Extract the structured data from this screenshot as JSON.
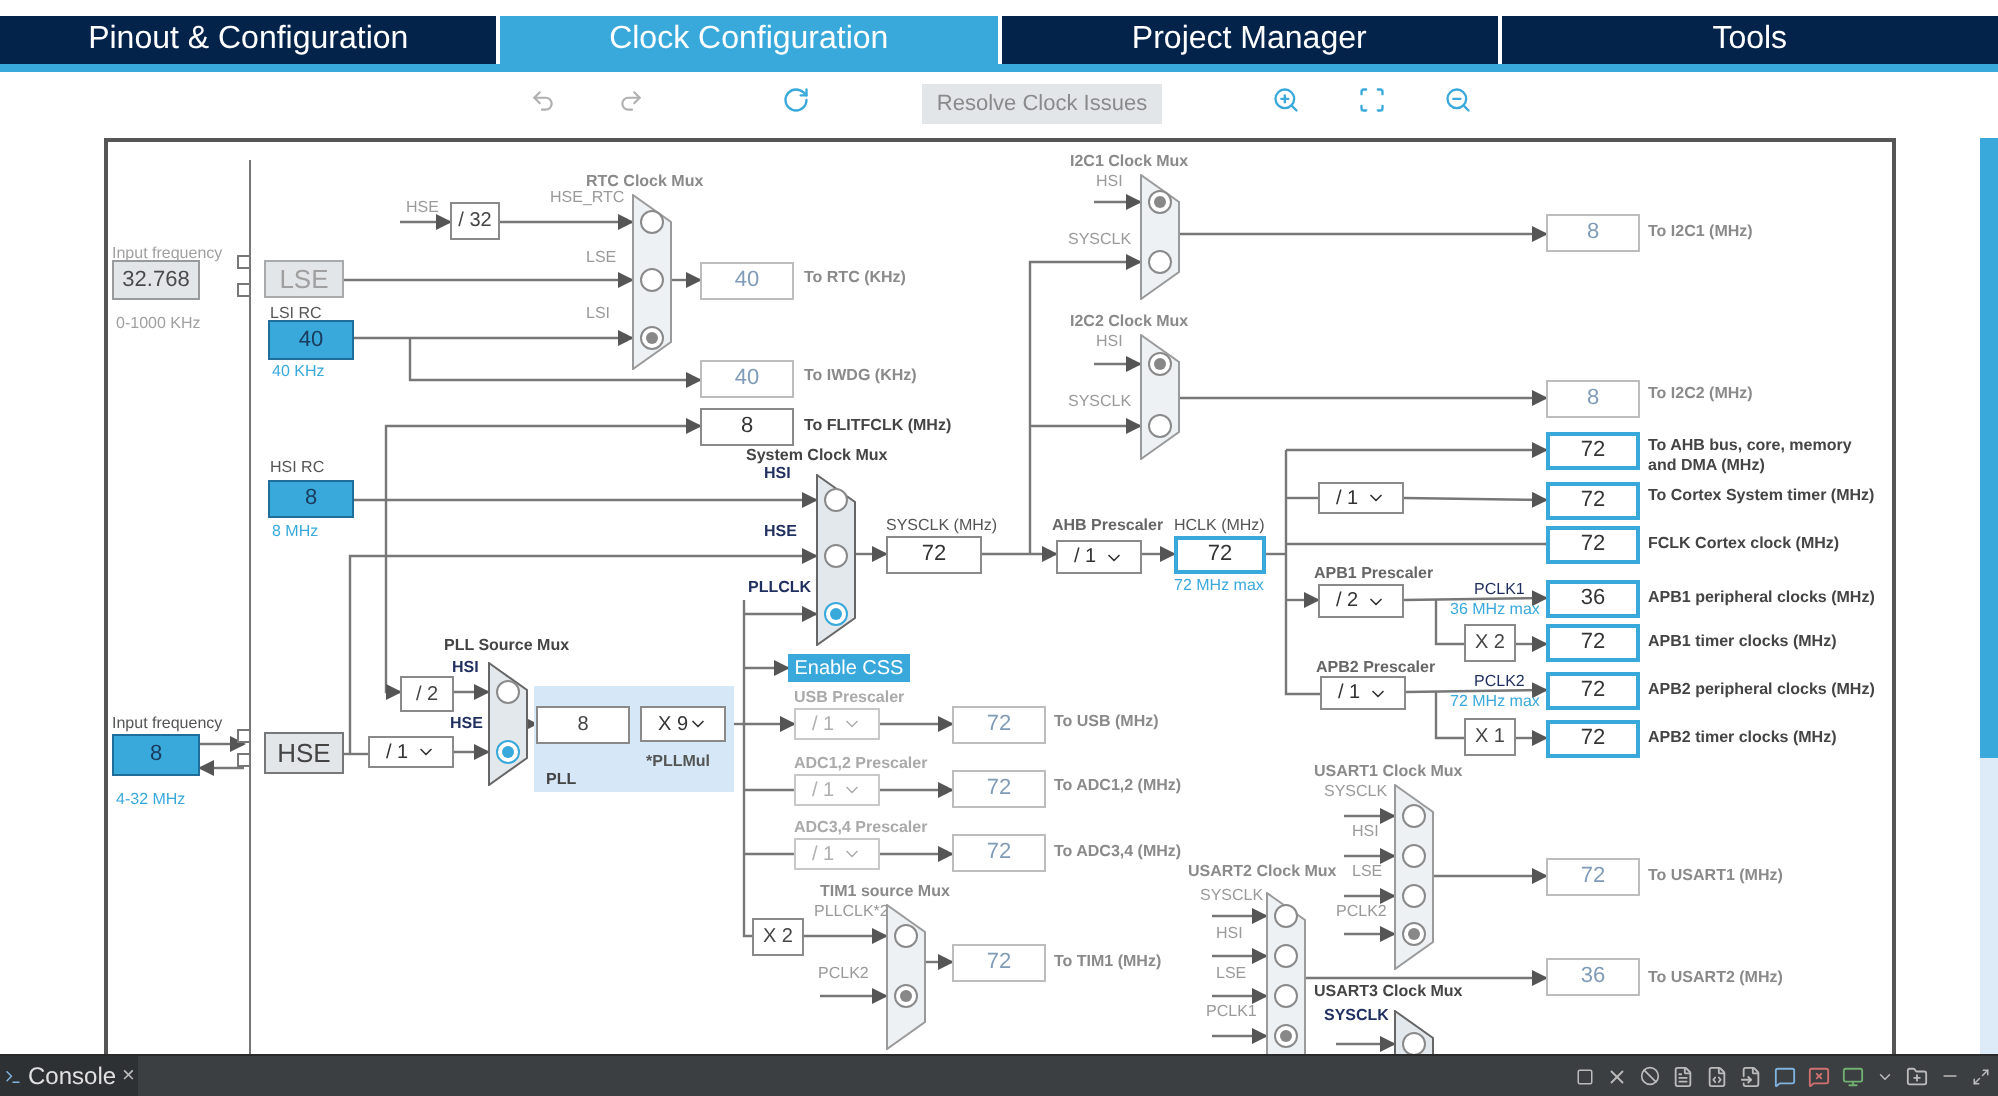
{
  "tabs": [
    {
      "label": "Pinout & Configuration",
      "selected": false
    },
    {
      "label": "Clock Configuration",
      "selected": true
    },
    {
      "label": "Project Manager",
      "selected": false
    },
    {
      "label": "Tools",
      "selected": false
    }
  ],
  "toolbar": {
    "resolve_button": {
      "label": "Resolve Clock Issues",
      "disabled": true
    }
  },
  "diagram": {
    "input_frequencies": [
      {
        "label": "Input frequency",
        "value": "32.768",
        "range": "0-1000 KHz",
        "active": false
      },
      {
        "label": "Input frequency",
        "value": "8",
        "range": "4-32 MHz",
        "active": true
      }
    ],
    "oscillators": [
      {
        "name": "LSE",
        "active": false
      },
      {
        "name": "HSE",
        "active": true
      }
    ],
    "rc_oscillators": [
      {
        "name": "LSI RC",
        "value": "40",
        "frequency": "40 KHz"
      },
      {
        "name": "HSI RC",
        "value": "8",
        "frequency": "8 MHz"
      }
    ],
    "wire_label": "HSE",
    "multipliers": [
      "/ 32",
      "/ 2",
      "X 2",
      "X 2",
      "X 1"
    ],
    "muxes": [
      {
        "title": "RTC Clock Mux",
        "active": false,
        "inputs": [
          {
            "label": "HSE_RTC",
            "selected": false
          },
          {
            "label": "LSE",
            "selected": false
          },
          {
            "label": "LSI",
            "selected": true
          }
        ]
      },
      {
        "title": "System Clock Mux",
        "active": true,
        "inputs": [
          {
            "label": "HSI",
            "selected": false
          },
          {
            "label": "HSE",
            "selected": false
          },
          {
            "label": "PLLCLK",
            "selected": true
          }
        ]
      },
      {
        "title": "PLL Source Mux",
        "active": true,
        "inputs": [
          {
            "label": "HSI",
            "selected": false
          },
          {
            "label": "HSE",
            "selected": true
          }
        ]
      },
      {
        "title": "I2C1 Clock Mux",
        "active": false,
        "inputs": [
          {
            "label": "HSI",
            "selected": true
          },
          {
            "label": "SYSCLK",
            "selected": false
          }
        ]
      },
      {
        "title": "I2C2 Clock Mux",
        "active": false,
        "inputs": [
          {
            "label": "HSI",
            "selected": true
          },
          {
            "label": "SYSCLK",
            "selected": false
          }
        ]
      },
      {
        "title": "TIM1 source Mux",
        "active": false,
        "inputs": [
          {
            "label": "PLLCLK*2",
            "selected": false
          },
          {
            "label": "PCLK2",
            "selected": true
          }
        ]
      },
      {
        "title": "USART1 Clock Mux",
        "active": false,
        "inputs": [
          {
            "label": "SYSCLK",
            "selected": false
          },
          {
            "label": "HSI",
            "selected": false
          },
          {
            "label": "LSE",
            "selected": false
          },
          {
            "label": "PCLK2",
            "selected": true
          }
        ]
      },
      {
        "title": "USART2 Clock Mux",
        "active": false,
        "inputs": [
          {
            "label": "SYSCLK",
            "selected": false
          },
          {
            "label": "HSI",
            "selected": false
          },
          {
            "label": "LSE",
            "selected": false
          },
          {
            "label": "PCLK1",
            "selected": true
          }
        ]
      },
      {
        "title": "USART3 Clock Mux",
        "active": true,
        "inputs": [
          {
            "label": "SYSCLK",
            "selected": false
          }
        ]
      }
    ],
    "prescalers": [
      {
        "value": "/ 1",
        "disabled": false
      },
      {
        "value": "X 9",
        "caption": "*PLLMul",
        "disabled": false
      },
      {
        "title": "USB Prescaler",
        "value": "/ 1",
        "disabled": true
      },
      {
        "title": "ADC1,2 Prescaler",
        "value": "/ 1",
        "disabled": true
      },
      {
        "title": "ADC3,4 Prescaler",
        "value": "/ 1",
        "disabled": true
      },
      {
        "title": "AHB Prescaler",
        "value": "/ 1",
        "disabled": false
      },
      {
        "value": "/ 1",
        "disabled": false
      },
      {
        "title": "APB1 Prescaler",
        "value": "/ 2",
        "disabled": false
      },
      {
        "title": "APB2 Prescaler",
        "value": "/ 1",
        "disabled": false
      }
    ],
    "pll": {
      "label": "PLL",
      "value": "8"
    },
    "sysclk": {
      "label": "SYSCLK (MHz)",
      "value": "72"
    },
    "hclk": {
      "label": "HCLK (MHz)",
      "value": "72",
      "max": "72 MHz max"
    },
    "bus_clocks": [
      {
        "name": "PCLK1",
        "max": "36 MHz max"
      },
      {
        "name": "PCLK2",
        "max": "72 MHz max"
      }
    ],
    "enable_css": "Enable CSS",
    "outputs": [
      {
        "value": "40",
        "label": "To RTC (KHz)",
        "highlighted": false,
        "disabled": true
      },
      {
        "value": "40",
        "label": "To IWDG (KHz)",
        "highlighted": false,
        "disabled": true
      },
      {
        "value": "8",
        "label": "To FLITFCLK (MHz)",
        "highlighted": false,
        "disabled": false
      },
      {
        "value": "8",
        "label": "To I2C1 (MHz)",
        "highlighted": false,
        "disabled": true
      },
      {
        "value": "8",
        "label": "To I2C2 (MHz)",
        "highlighted": false,
        "disabled": true
      },
      {
        "value": "72",
        "label": "To AHB bus, core, memory and DMA (MHz)",
        "highlighted": true,
        "disabled": false
      },
      {
        "value": "72",
        "label": "To Cortex System timer (MHz)",
        "highlighted": true,
        "disabled": false
      },
      {
        "value": "72",
        "label": "FCLK Cortex clock (MHz)",
        "highlighted": true,
        "disabled": false
      },
      {
        "value": "36",
        "label": "APB1 peripheral clocks (MHz)",
        "highlighted": true,
        "disabled": false
      },
      {
        "value": "72",
        "label": "APB1 timer clocks (MHz)",
        "highlighted": true,
        "disabled": false
      },
      {
        "value": "72",
        "label": "APB2 peripheral clocks (MHz)",
        "highlighted": true,
        "disabled": false
      },
      {
        "value": "72",
        "label": "APB2 timer clocks (MHz)",
        "highlighted": true,
        "disabled": false
      },
      {
        "value": "72",
        "label": "To USB (MHz)",
        "highlighted": false,
        "disabled": true
      },
      {
        "value": "72",
        "label": "To ADC1,2 (MHz)",
        "highlighted": false,
        "disabled": true
      },
      {
        "value": "72",
        "label": "To ADC3,4 (MHz)",
        "highlighted": false,
        "disabled": true
      },
      {
        "value": "72",
        "label": "To TIM1 (MHz)",
        "highlighted": false,
        "disabled": true
      },
      {
        "value": "72",
        "label": "To USART1 (MHz)",
        "highlighted": false,
        "disabled": true
      },
      {
        "value": "36",
        "label": "To USART2 (MHz)",
        "highlighted": false,
        "disabled": true
      }
    ]
  },
  "console": {
    "tab": "Console",
    "close": "×"
  }
}
